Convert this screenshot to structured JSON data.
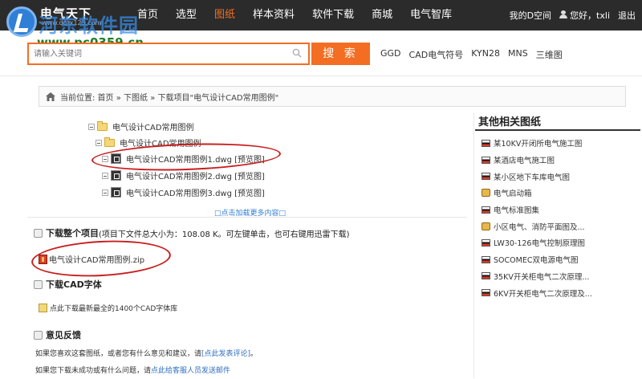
{
  "brand": {
    "logo_text": "电气天下",
    "logo_sub": "www.dqtx123.com",
    "watermark": "河东软件园",
    "watermark_url": "www.pc0359.cn"
  },
  "nav": {
    "items": [
      "首页",
      "选型",
      "图纸",
      "样本资料",
      "软件下载",
      "商城",
      "电气智库"
    ],
    "active_index": 2,
    "my_space": "我的D空间",
    "greeting": "您好，txli",
    "logout": "退出"
  },
  "search": {
    "placeholder": "请输入关键词",
    "button_label": "搜 索",
    "hot_words": [
      "GGD",
      "CAD电气符号",
      "KYN28",
      "MNS",
      "三维图"
    ]
  },
  "breadcrumb": {
    "text": "当前位置: 首页 » 下图纸 » 下载项目\"电气设计CAD常用图例\""
  },
  "tree": {
    "root": "电气设计CAD常用图例",
    "child": "电气设计CAD常用图例",
    "files": [
      "电气设计CAD常用图例1.dwg [预览图]",
      "电气设计CAD常用图例2.dwg [预览图]",
      "电气设计CAD常用图例3.dwg [预览图]"
    ],
    "load_more": "□点击加载更多内容□"
  },
  "download_all": {
    "title": "下载整个项目",
    "desc": "(项目下文件总大小为：108.08 K。可左键单击，也可右键用迅雷下载)",
    "zip_name": "电气设计CAD常用图例.zip"
  },
  "cad_font": {
    "title": "下载CAD字体",
    "link": "点此下载最新最全的1400个CAD字体库"
  },
  "feedback": {
    "title": "意见反馈",
    "line1_prefix": "如果您喜欢这套图纸，或者您有什么意见和建议，请",
    "line1_link": "[点此发表评论]",
    "line1_suffix": "。",
    "line2_prefix": "如果您下载未成功或有什么问题，请",
    "line2_link": "点此给客服人员发送邮件"
  },
  "sidebar": {
    "title": "其他相关图纸",
    "items": [
      {
        "label": "某10KV开闭所电气施工图",
        "icon": "flag-icon"
      },
      {
        "label": "某酒店电气施工图",
        "icon": "flag-icon"
      },
      {
        "label": "某小区地下车库电气图",
        "icon": "flag-icon"
      },
      {
        "label": "电气启动箱",
        "icon": "star-icon"
      },
      {
        "label": "电气标准图集",
        "icon": "flag-icon"
      },
      {
        "label": "小区电气、消防平面图及...",
        "icon": "star-icon"
      },
      {
        "label": "LW30-126电气控制原理图",
        "icon": "flag-icon"
      },
      {
        "label": "SOCOMEC双电源电气图",
        "icon": "flag-icon"
      },
      {
        "label": "35KV开关柜电气二次原理...",
        "icon": "flag-icon"
      },
      {
        "label": "6KV开关柜电气二次原理及...",
        "icon": "flag-icon"
      }
    ]
  },
  "colors": {
    "topbar": "#2b2b2b",
    "accent": "#f36e22",
    "annotation_circle": "#c81e1e"
  }
}
